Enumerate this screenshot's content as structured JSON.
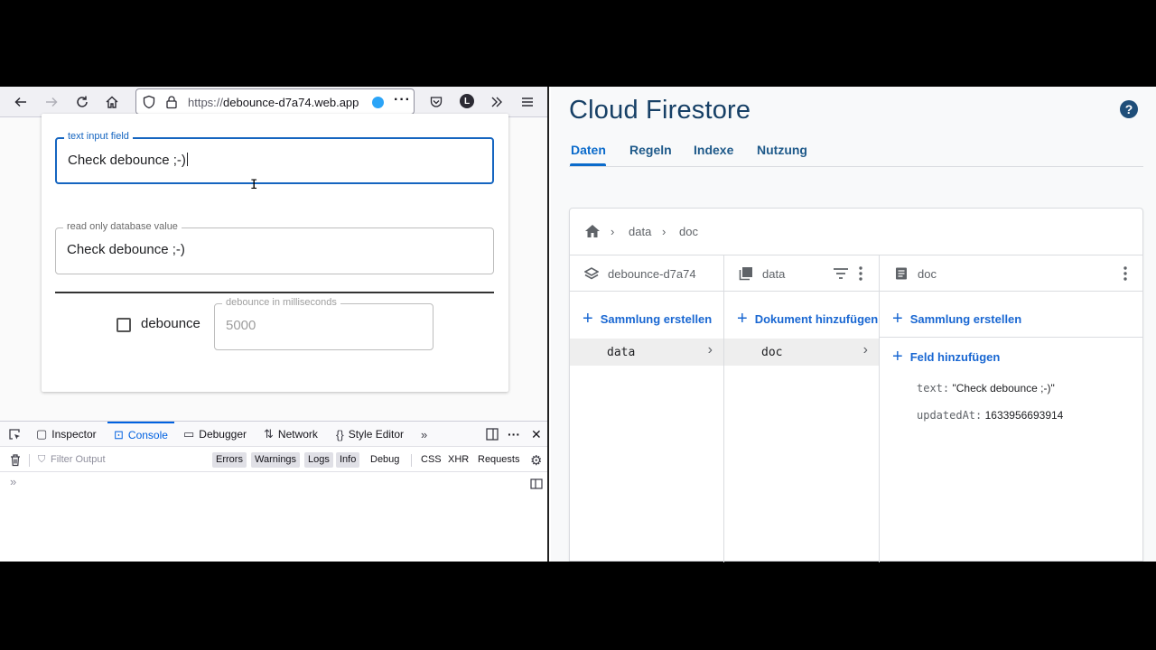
{
  "browser": {
    "url_protocol": "https://",
    "url_host": "debounce-d7a74.web.app",
    "avatar_letter": "L"
  },
  "app": {
    "text_input": {
      "label": "text input field",
      "value": "Check debounce ;-)"
    },
    "readonly_input": {
      "label": "read only database value",
      "value": "Check debounce ;-)"
    },
    "debounce_checkbox": {
      "label": "debounce",
      "checked": false
    },
    "ms_input": {
      "label": "debounce in milliseconds",
      "value": "5000"
    }
  },
  "devtools": {
    "tabs": [
      "Inspector",
      "Console",
      "Debugger",
      "Network",
      "Style Editor"
    ],
    "active_tab": "Console",
    "filter_placeholder": "Filter Output",
    "levels": [
      "Errors",
      "Warnings",
      "Logs",
      "Info",
      "Debug"
    ],
    "types": [
      "CSS",
      "XHR",
      "Requests"
    ],
    "prompt": "»"
  },
  "firestore": {
    "title": "Cloud Firestore",
    "help": "?",
    "tabs": [
      "Daten",
      "Regeln",
      "Indexe",
      "Nutzung"
    ],
    "breadcrumb": [
      "data",
      "doc"
    ],
    "columns": {
      "root": {
        "header": "debounce-d7a74",
        "add_label": "Sammlung erstellen",
        "items": [
          "data"
        ]
      },
      "collection": {
        "header": "data",
        "add_label": "Dokument hinzufügen",
        "items": [
          "doc"
        ]
      },
      "document": {
        "header": "doc",
        "add_collection_label": "Sammlung erstellen",
        "add_field_label": "Feld hinzufügen",
        "fields": [
          {
            "key": "text:",
            "value": "\"Check debounce ;-)\""
          },
          {
            "key": "updatedAt:",
            "value": "1633956693914"
          }
        ]
      }
    }
  }
}
